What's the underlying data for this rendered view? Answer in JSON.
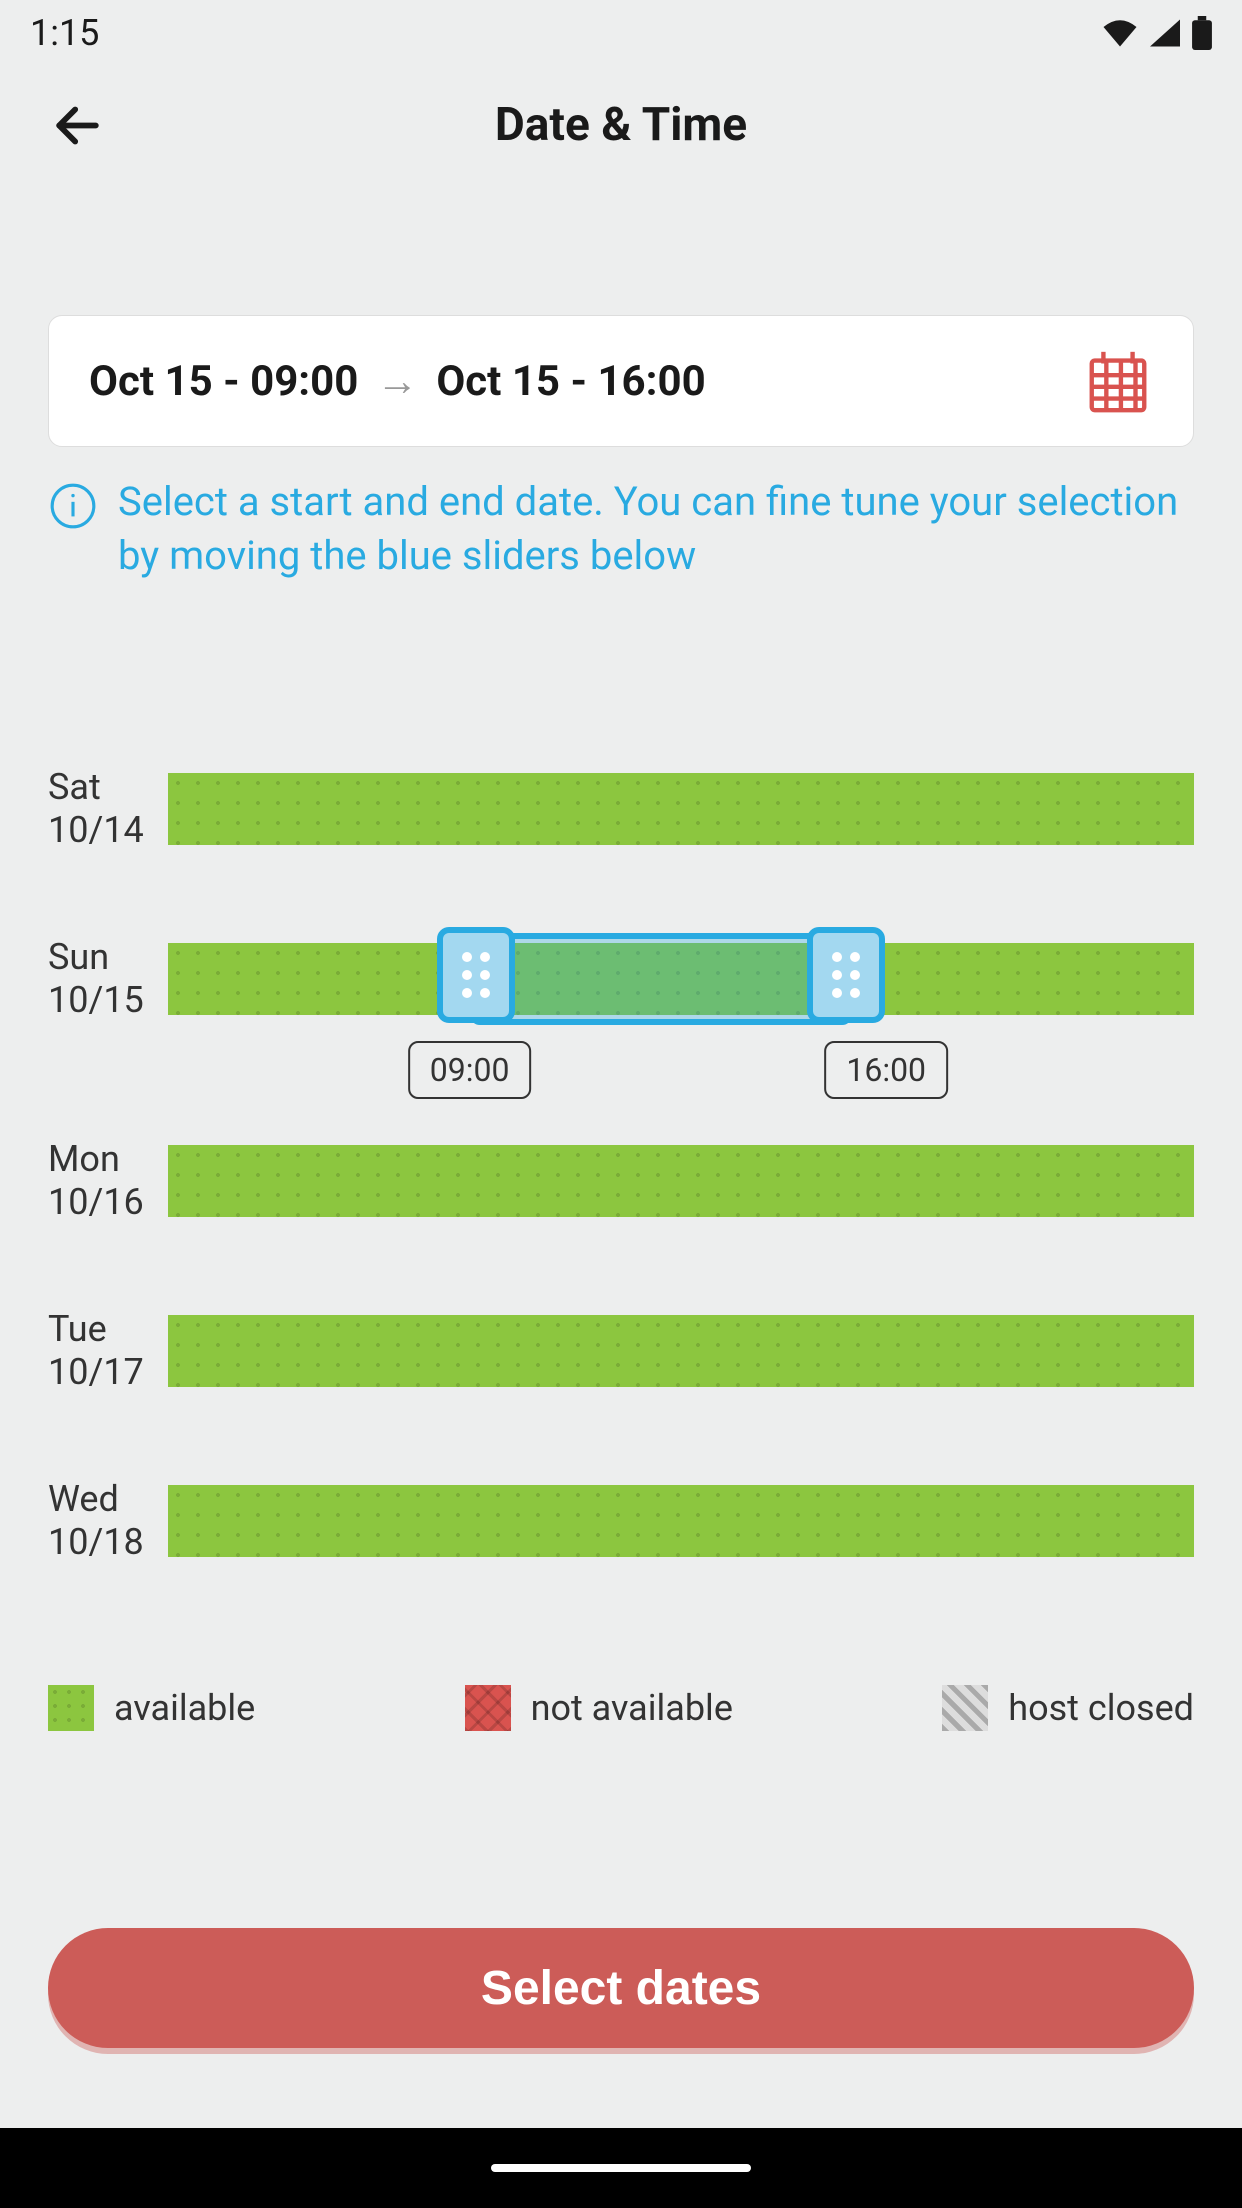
{
  "statusBar": {
    "time": "1:15"
  },
  "header": {
    "title": "Date & Time"
  },
  "dateRange": {
    "start": "Oct 15 - 09:00",
    "end": "Oct 15 - 16:00"
  },
  "info": {
    "text": "Select a start and end date. You can fine tune your selection by moving the blue sliders below"
  },
  "days": [
    {
      "dow": "Sat",
      "date": "10/14"
    },
    {
      "dow": "Sun",
      "date": "10/15"
    },
    {
      "dow": "Mon",
      "date": "10/16"
    },
    {
      "dow": "Tue",
      "date": "10/17"
    },
    {
      "dow": "Wed",
      "date": "10/18"
    }
  ],
  "selection": {
    "dayIndex": 1,
    "startTime": "09:00",
    "endTime": "16:00",
    "startPercent": 29.4,
    "endPercent": 66.7
  },
  "legend": {
    "available": "available",
    "notAvailable": "not available",
    "hostClosed": "host closed"
  },
  "button": {
    "label": "Select dates"
  },
  "colors": {
    "accent": "#29aae1",
    "danger": "#cc5c58",
    "available": "#8cc63f"
  }
}
